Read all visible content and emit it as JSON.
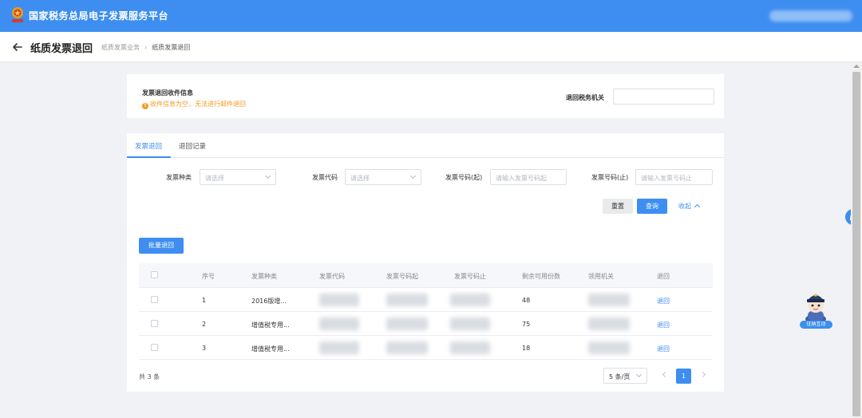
{
  "header": {
    "site_title": "国家税务总局电子发票服务平台"
  },
  "subheader": {
    "title": "纸质发票退回",
    "breadcrumb": [
      "纸质发票业务",
      "纸质发票退回"
    ],
    "breadcrumb_sep": "›"
  },
  "recipient_info": {
    "title": "发票退回收件信息",
    "warning": "收件信息为空，无法进行邮件退回",
    "warning_icon": "!",
    "tax_office_label": "退回税务机关",
    "tax_office_value": ""
  },
  "tabs": [
    {
      "label": "发票退回",
      "active": true
    },
    {
      "label": "退回记录",
      "active": false
    }
  ],
  "filters": {
    "invoice_type": {
      "label": "发票种类",
      "placeholder": "请选择"
    },
    "invoice_code": {
      "label": "发票代码",
      "placeholder": "请选择"
    },
    "invoice_no_start": {
      "label": "发票号码(起)",
      "placeholder": "请输入发票号码起"
    },
    "invoice_no_end": {
      "label": "发票号码(止)",
      "placeholder": "请输入发票号码止"
    }
  },
  "buttons": {
    "reset": "重置",
    "query": "查询",
    "collapse": "收起",
    "batch_return": "批量退回"
  },
  "table": {
    "columns": [
      "序号",
      "发票种类",
      "发票代码",
      "发票号码起",
      "发票号码止",
      "剩余可用份数",
      "领用机关",
      "退回"
    ],
    "rows": [
      {
        "seq": "1",
        "type": "2016版增...",
        "remaining": "48",
        "action": "退回"
      },
      {
        "seq": "2",
        "type": "增值税专用...",
        "remaining": "75",
        "action": "退回"
      },
      {
        "seq": "3",
        "type": "增值税专用...",
        "remaining": "18",
        "action": "退回"
      }
    ]
  },
  "pagination": {
    "total": "共 3 条",
    "page_size": "5 条/页",
    "current_page": "1"
  },
  "assistant": {
    "label": "征纳互动"
  },
  "colors": {
    "primary": "#3d8ef0",
    "warning": "#f59a23",
    "page_bg": "#f0f2f5"
  }
}
